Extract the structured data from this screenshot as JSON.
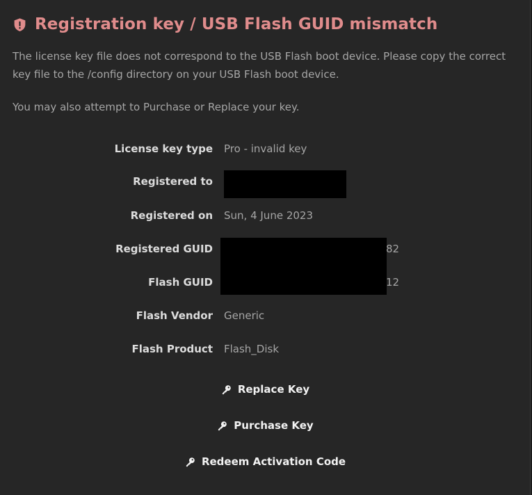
{
  "header": {
    "title": "Registration key / USB Flash GUID mismatch",
    "icon": "shield-alert-icon",
    "accent_color": "#e08c8c"
  },
  "messages": {
    "mismatch": "The license key file does not correspond to the USB Flash boot device. Please copy the correct key file to the /config directory on your USB Flash boot device.",
    "options": "You may also attempt to Purchase or Replace your key."
  },
  "details": {
    "license_key_type": {
      "label": "License key type",
      "value": "Pro - invalid key"
    },
    "registered_to": {
      "label": "Registered to",
      "value": ""
    },
    "registered_on": {
      "label": "Registered on",
      "value": "Sun, 4 June 2023"
    },
    "registered_guid": {
      "label": "Registered GUID",
      "value_suffix": "82"
    },
    "flash_guid": {
      "label": "Flash GUID",
      "value_suffix": "12"
    },
    "flash_vendor": {
      "label": "Flash Vendor",
      "value": "Generic"
    },
    "flash_product": {
      "label": "Flash Product",
      "value": "Flash_Disk"
    }
  },
  "actions": {
    "replace_key": {
      "label": "Replace Key",
      "icon": "key-icon"
    },
    "purchase_key": {
      "label": "Purchase Key",
      "icon": "key-icon"
    },
    "redeem_code": {
      "label": "Redeem Activation Code",
      "icon": "key-icon"
    }
  }
}
